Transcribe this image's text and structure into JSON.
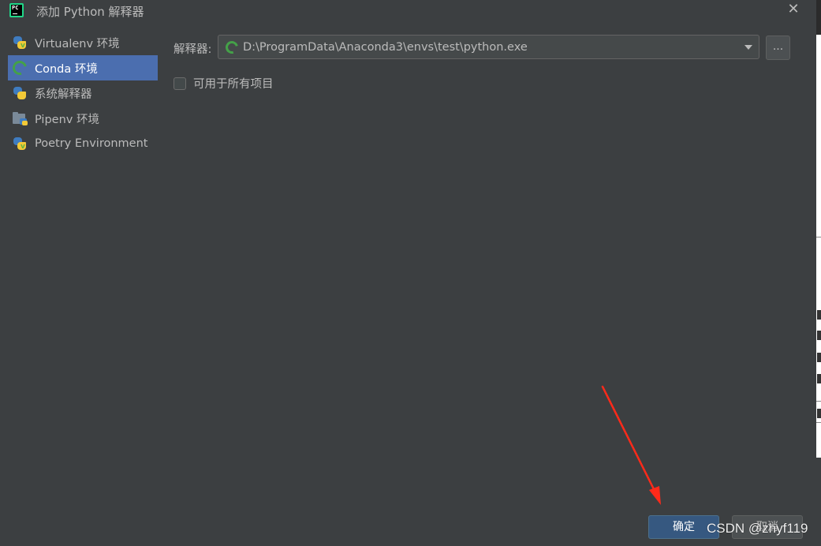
{
  "window": {
    "title": "添加 Python 解释器",
    "close_glyph": "✕"
  },
  "sidebar": {
    "items": [
      {
        "label": "Virtualenv 环境",
        "icon": "python-venv-icon"
      },
      {
        "label": "Conda 环境",
        "icon": "conda-icon",
        "selected": true
      },
      {
        "label": "系统解释器",
        "icon": "python-icon"
      },
      {
        "label": "Pipenv 环境",
        "icon": "pipenv-icon"
      },
      {
        "label": "Poetry Environment",
        "icon": "python-venv-icon"
      }
    ]
  },
  "main": {
    "interpreter_label": "解释器:",
    "interpreter_value": "D:\\ProgramData\\Anaconda3\\envs\\test\\python.exe",
    "browse_label": "...",
    "all_projects_label": "可用于所有项目",
    "all_projects_checked": false
  },
  "buttons": {
    "ok": "确定",
    "cancel": "取消"
  },
  "watermark": "CSDN @zhyf119",
  "colors": {
    "accent": "#4b6eaf",
    "ok_button": "#365880",
    "annotation_arrow": "#ff2a1a",
    "conda_green": "#44a148"
  }
}
